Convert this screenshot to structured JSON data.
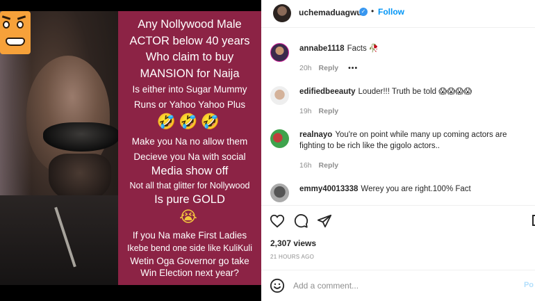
{
  "media": {
    "card_lines": [
      "Any Nollywood Male",
      "ACTOR below 40 years",
      "Who claim to buy",
      "MANSION for Naija",
      "Is either into Sugar Mummy",
      "Runs or Yahoo Yahoo Plus",
      "🤣🤣🤣",
      "Make you Na no allow them",
      "Decieve you Na with social",
      "Media show off",
      "Not all that glitter for Nollywood",
      "Is pure GOLD",
      "😭",
      "If you Na make First Ladies",
      "Ikebe bend one side like KuliKuli",
      "Wetin Oga Governor go take",
      "Win Election next year?"
    ],
    "card_color": "#8c2345"
  },
  "header": {
    "username": "uchemaduagwu",
    "separator": "•",
    "follow_label": "Follow",
    "verified_glyph": "✓"
  },
  "comments": [
    {
      "username": "annabe1118",
      "text": "Facts 🥀",
      "time": "20h",
      "reply_label": "Reply",
      "more_label": "•••"
    },
    {
      "username": "edifiedbeeauty",
      "text": "Louder!!! Truth be told 😱😱😱😱",
      "time": "19h",
      "reply_label": "Reply"
    },
    {
      "username": "realnayo",
      "text": "You're on point while many up coming actors are fighting to be rich like the gigolo actors..",
      "time": "16h",
      "reply_label": "Reply"
    },
    {
      "username": "emmy40013338",
      "text": "Werey you are right.100% Fact"
    }
  ],
  "actions": {
    "icons": [
      "heart-icon",
      "comment-icon",
      "share-icon",
      "save-icon"
    ],
    "views": "2,307 views",
    "time_ago": "21 HOURS AGO"
  },
  "add_comment": {
    "placeholder": "Add a comment...",
    "post_label": "Po"
  },
  "colors": {
    "accent": "#0095f6",
    "verified": "#3897f0",
    "muted": "#8e8e8e"
  }
}
